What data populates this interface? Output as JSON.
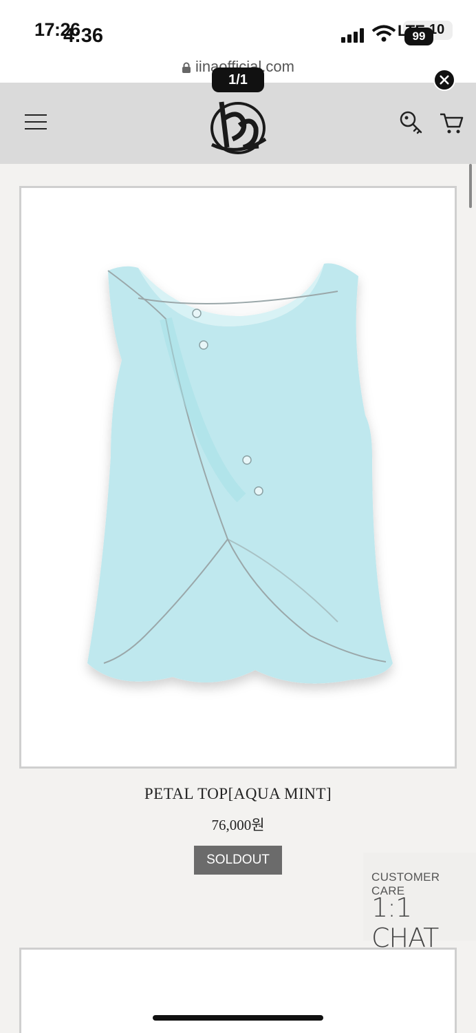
{
  "status": {
    "time_a": "17:26",
    "time_b": "4:36",
    "network": "LTE",
    "battery": "10",
    "badge": "99"
  },
  "browser": {
    "url": "iinaofficial.com",
    "image_counter": "1/1"
  },
  "product": {
    "name": "PETAL TOP[AQUA MINT]",
    "price": "76,000원",
    "status_label": "SOLDOUT",
    "garment_color": "#bfe8ee"
  },
  "customer_care": {
    "label": "CUSTOMER CARE",
    "chat": "1:1 CHAT"
  },
  "icons": [
    "menu-icon",
    "logo",
    "key-icon",
    "cart-icon",
    "lock-icon",
    "close-icon"
  ],
  "colors": {
    "header_bg": "#dadada",
    "page_bg": "#f3f2f0",
    "soldout_bg": "#6b6b6b"
  }
}
